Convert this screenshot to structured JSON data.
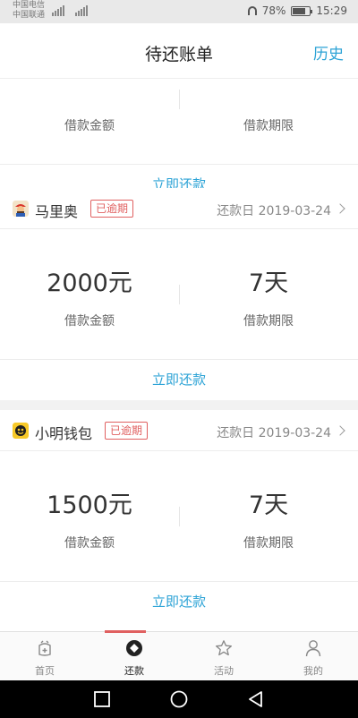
{
  "status_bar": {
    "carrier_1": "中国电信",
    "carrier_2": "中国联通",
    "battery": "78%",
    "time": "15:29"
  },
  "header": {
    "title": "待还账单",
    "history_label": "历史"
  },
  "partial_card": {
    "amount_label": "借款金额",
    "term_label": "借款期限",
    "repay_label": "立即还款"
  },
  "loans": [
    {
      "lender": "马里奥",
      "avatar_icon": "mario-icon",
      "badge": "已逾期",
      "due_date": "还款日 2019-03-24",
      "amount": "2000元",
      "amount_label": "借款金额",
      "term": "7天",
      "term_label": "借款期限",
      "repay_label": "立即还款"
    },
    {
      "lender": "小明钱包",
      "avatar_icon": "xiaoming-wallet-icon",
      "badge": "已逾期",
      "due_date": "还款日 2019-03-24",
      "amount": "1500元",
      "amount_label": "借款金额",
      "term": "7天",
      "term_label": "借款期限",
      "repay_label": "立即还款"
    }
  ],
  "tabs": [
    {
      "label": "首页",
      "icon": "home-bag-icon",
      "active": false
    },
    {
      "label": "还款",
      "icon": "repay-icon",
      "active": true
    },
    {
      "label": "活动",
      "icon": "star-icon",
      "active": false
    },
    {
      "label": "我的",
      "icon": "person-icon",
      "active": false
    }
  ],
  "colors": {
    "accent": "#2ca3d6",
    "overdue": "#e06060"
  }
}
